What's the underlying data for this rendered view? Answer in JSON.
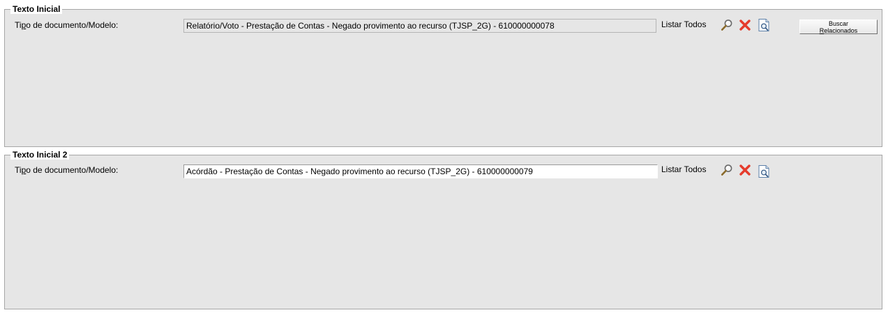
{
  "sections": [
    {
      "legend": "Texto Inicial",
      "label_pre": "Ti",
      "label_u": "p",
      "label_post": "o de documento/Modelo:",
      "value": "Relatório/Voto - Prestação de Contas - Negado provimento ao recurso (TJSP_2G) - 610000000078",
      "list_all": "Listar Todos",
      "button_line1": "Buscar",
      "button_line2": "Relacionados"
    },
    {
      "legend": "Texto Inicial 2",
      "label_pre": "Ti",
      "label_u": "p",
      "label_post": "o de documento/Modelo:",
      "value": "Acórdão - Prestação de Contas - Negado provimento ao recurso (TJSP_2G) - 610000000079",
      "list_all": "Listar Todos"
    }
  ],
  "icons": {
    "search": "magnifier-icon",
    "clear": "red-x-icon",
    "preview": "document-preview-icon"
  },
  "colors": {
    "panel_bg": "#e6e6e6",
    "border": "#a6a6a6",
    "clear_red": "#e53b2c"
  }
}
